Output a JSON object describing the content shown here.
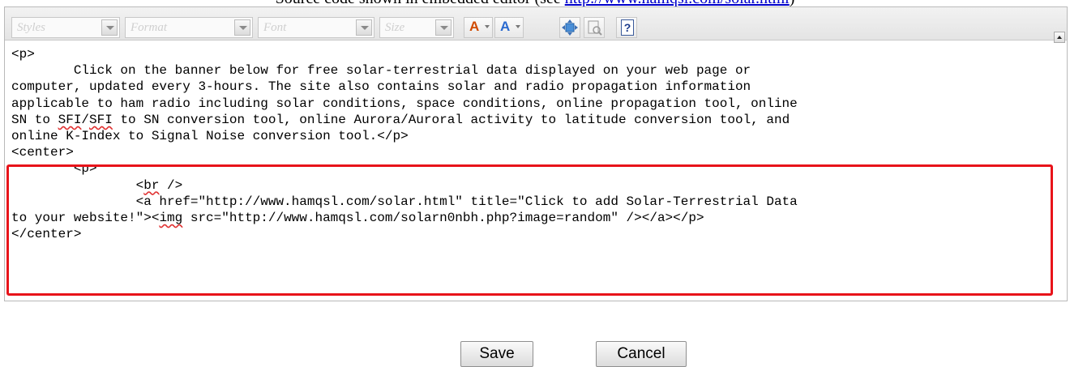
{
  "caption": {
    "prefix": "Source code shown in embedded editor (see ",
    "link": "http://www.hamqsl.com/solar.html",
    "suffix": ")"
  },
  "toolbar": {
    "styles_placeholder": "Styles",
    "format_placeholder": "Format",
    "font_placeholder": "Font",
    "size_placeholder": "Size",
    "text_color_label": "A",
    "bg_color_label": "A",
    "help_label": "?",
    "text_color": "#d04a00",
    "bg_color": "#2a6ad0",
    "icons": [
      "text-color-icon",
      "background-color-icon",
      "maximize-icon",
      "show-blocks-icon",
      "help-icon"
    ]
  },
  "code": {
    "l1": "<p>",
    "l2": "\tClick on the banner below for free solar-terrestrial data displayed on your web page or",
    "l3": "computer, updated every 3-hours. The site also contains solar and radio propagation information",
    "l4": "applicable to ham radio including solar conditions, space conditions, online propagation tool, online",
    "l5a": "SN to ",
    "l5b": "SFI",
    "l5c": "/",
    "l5d": "SFI",
    "l5e": " to SN conversion tool, online Aurora/Auroral activity to latitude conversion tool, and",
    "l6": "online K-Index to Signal Noise conversion tool.</p>",
    "l7": "<center>",
    "l8": "\t<p>",
    "l9a": "\t\t<",
    "l9b": "br",
    "l9c": " />",
    "l10": "\t\t<a href=\"http://www.hamqsl.com/solar.html\" title=\"Click to add Solar-Terrestrial Data",
    "l11a": "to your website!\"><",
    "l11b": "img",
    "l11c": " src=\"http://www.hamqsl.com/solarn0nbh.php?image=random\" /></a></p>",
    "l12": "</center>"
  },
  "buttons": {
    "save": "Save",
    "cancel": "Cancel"
  }
}
